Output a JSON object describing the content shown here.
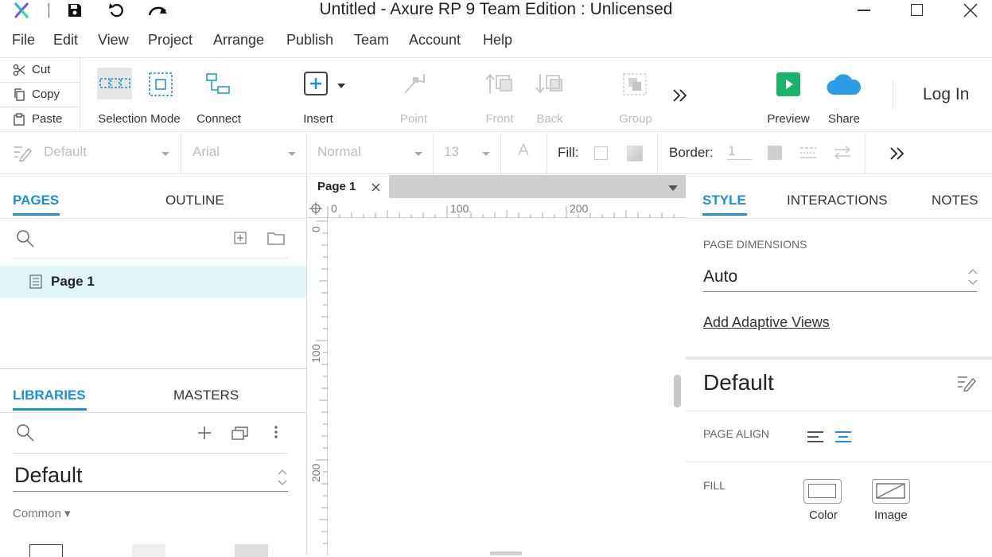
{
  "window": {
    "title": "Untitled - Axure RP 9 Team Edition : Unlicensed"
  },
  "menu": [
    "File",
    "Edit",
    "View",
    "Project",
    "Arrange",
    "Publish",
    "Team",
    "Account",
    "Help"
  ],
  "clipboard": {
    "cut": "Cut",
    "copy": "Copy",
    "paste": "Paste"
  },
  "toolbar": {
    "selection_mode": "Selection Mode",
    "connect": "Connect",
    "insert": "Insert",
    "point": "Point",
    "front": "Front",
    "back": "Back",
    "group": "Group",
    "preview": "Preview",
    "share": "Share",
    "login": "Log In"
  },
  "format": {
    "style": "Default",
    "font": "Arial",
    "weight": "Normal",
    "size": "13",
    "fill_label": "Fill:",
    "border_label": "Border:",
    "border_width": "1"
  },
  "pages_panel": {
    "tab_pages": "PAGES",
    "tab_outline": "OUTLINE",
    "pages": [
      "Page 1"
    ]
  },
  "libraries_panel": {
    "tab_libraries": "LIBRARIES",
    "tab_masters": "MASTERS",
    "library": "Default",
    "category": "Common ▾"
  },
  "canvas": {
    "tab": "Page 1",
    "ruler_h": [
      "0",
      "100",
      "200"
    ],
    "ruler_v": [
      "0",
      "100",
      "200"
    ]
  },
  "inspector": {
    "tab_style": "STYLE",
    "tab_interactions": "INTERACTIONS",
    "tab_notes": "NOTES",
    "page_dimensions_label": "PAGE DIMENSIONS",
    "page_dimensions_value": "Auto",
    "add_adaptive_views": "Add Adaptive Views",
    "style_name": "Default",
    "page_align_label": "PAGE ALIGN",
    "fill_label": "FILL",
    "fill_color": "Color",
    "fill_image": "Image"
  },
  "colors": {
    "accent": "#1b8fd8",
    "selected_row": "#e0f5f8",
    "preview_green": "#19b36b",
    "share_blue": "#2e9be6"
  }
}
